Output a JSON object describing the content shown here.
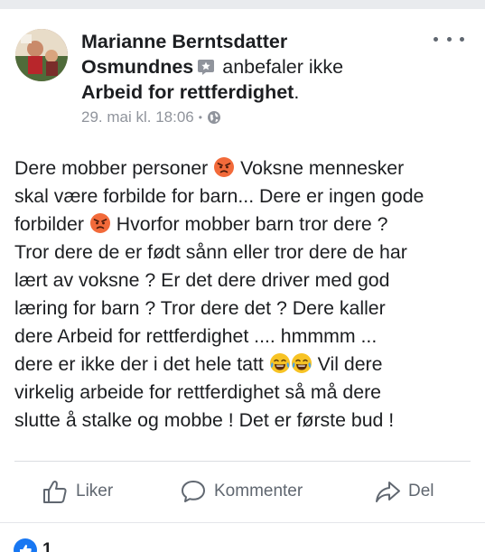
{
  "post": {
    "author_line1": "Marianne Berntsdatter",
    "author_line2": "Osmundnes",
    "verb": "anbefaler ikke",
    "page_name": "Arbeid for rettferdighet",
    "page_name_suffix": ".",
    "timestamp": "29. mai kl. 18:06",
    "meta_separator": "•",
    "audience_icon": "globe-icon",
    "badge_icon": "recommendation-badge-icon",
    "body_lines": [
      {
        "pre": "Dere mobber personer ",
        "emoji": "angry-face-icon",
        "post": " Voksne mennesker"
      },
      {
        "pre": "skal være forbilde for barn... Dere er ingen gode",
        "emoji": "",
        "post": ""
      },
      {
        "pre": "forbilder ",
        "emoji": "angry-face-icon",
        "post": " Hvorfor mobber barn tror dere ?"
      },
      {
        "pre": "Tror dere de er født sånn eller tror dere de har",
        "emoji": "",
        "post": ""
      },
      {
        "pre": "lært av voksne ? Er det dere driver med god",
        "emoji": "",
        "post": ""
      },
      {
        "pre": "læring for barn ? Tror dere det ? Dere kaller",
        "emoji": "",
        "post": ""
      },
      {
        "pre": "dere Arbeid for rettferdighet .... hmmmm ...",
        "emoji": "",
        "post": ""
      },
      {
        "pre": "dere er ikke der i det hele tatt ",
        "emoji": "crying-laughing-icon",
        "post": " Vil dere"
      },
      {
        "pre": "virkelig arbeide for rettferdighet så må dere",
        "emoji": "",
        "post": ""
      },
      {
        "pre": "slutte å stalke og mobbe ! Det er første bud !",
        "emoji": "",
        "post": ""
      }
    ]
  },
  "actions": {
    "like_label": "Liker",
    "comment_label": "Kommenter",
    "share_label": "Del"
  },
  "reactions": {
    "count": "1",
    "icon": "like-reaction-icon"
  },
  "colors": {
    "text": "#1c1e21",
    "secondary": "#90949c",
    "action_text": "#606770",
    "background": "#e9ebee",
    "angry_emoji": "#f26a3a",
    "reaction_blue": "#1877f2"
  }
}
